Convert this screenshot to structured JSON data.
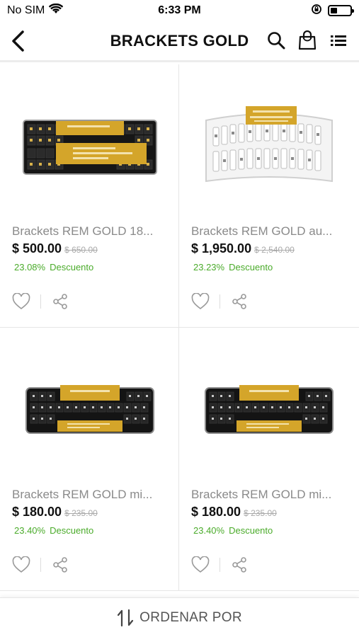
{
  "status_bar": {
    "carrier": "No SIM",
    "time": "6:33 PM",
    "battery_level": 0.35
  },
  "header": {
    "title": "BRACKETS GOLD"
  },
  "products": [
    {
      "name": "Brackets REM GOLD 18...",
      "price": "$ 500.00",
      "old_price": "$ 650.00",
      "discount_pct": "23.08%",
      "discount_label": "Descuento",
      "image": "black-bracket-case"
    },
    {
      "name": "Brackets REM GOLD au...",
      "price": "$ 1,950.00",
      "old_price": "$ 2,540.00",
      "discount_pct": "23.23%",
      "discount_label": "Descuento",
      "image": "white-bracket-tray"
    },
    {
      "name": "Brackets REM GOLD mi...",
      "price": "$ 180.00",
      "old_price": "$ 235.00",
      "discount_pct": "23.40%",
      "discount_label": "Descuento",
      "image": "black-bracket-case"
    },
    {
      "name": "Brackets REM GOLD mi...",
      "price": "$ 180.00",
      "old_price": "$ 235.00",
      "discount_pct": "23.40%",
      "discount_label": "Descuento",
      "image": "black-bracket-case"
    }
  ],
  "sort_bar": {
    "label": "ORDENAR POR"
  },
  "colors": {
    "discount": "#4aab2a",
    "gold_label": "#d4a52a",
    "case_black": "#141414"
  }
}
